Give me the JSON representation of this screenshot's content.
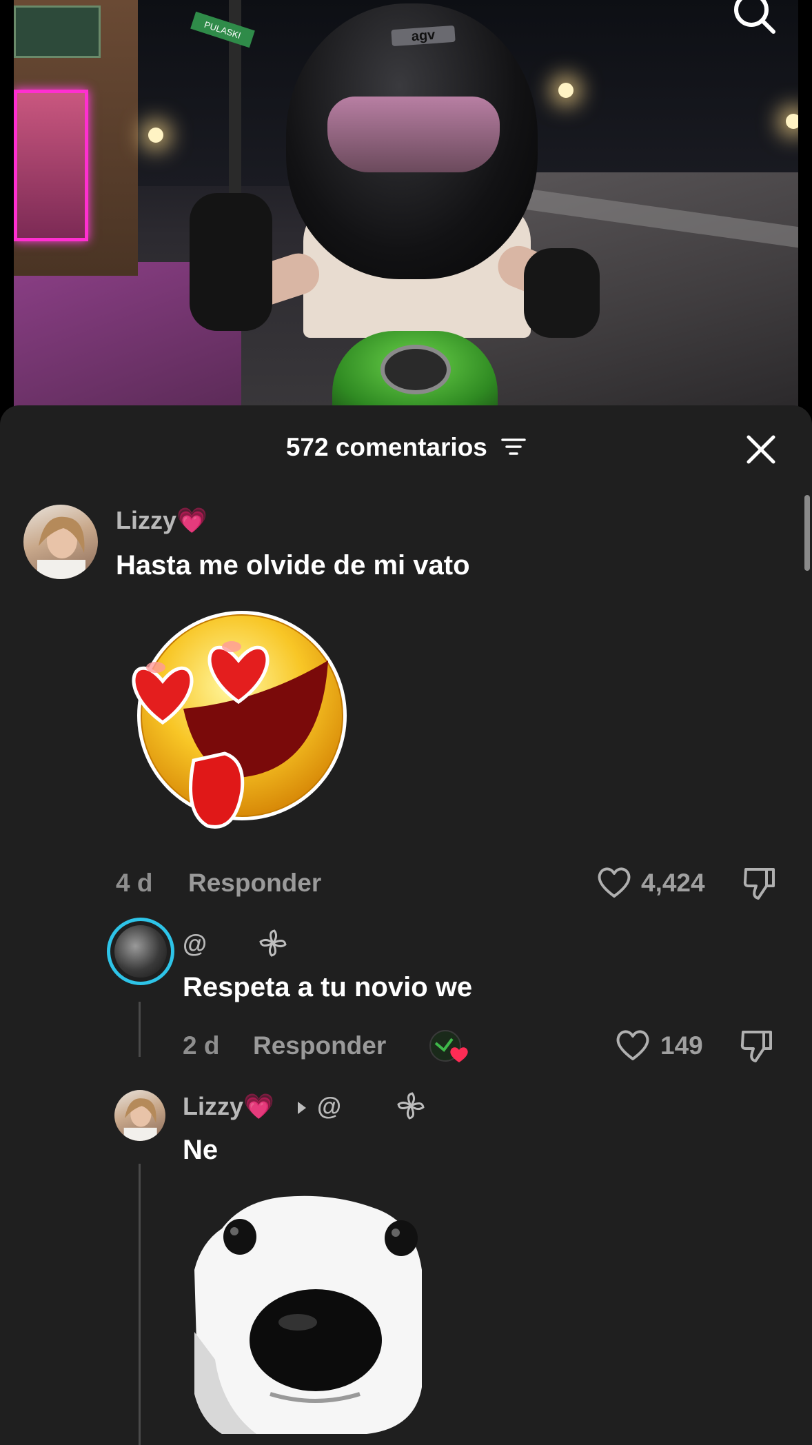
{
  "video": {
    "street_sign": "PULASKI",
    "helmet_brand": "agv"
  },
  "comments_sheet": {
    "title": "572 comentarios",
    "comments": [
      {
        "author": "Lizzy💗",
        "text": "Hasta me olvide de mi vato",
        "sticker": "heart-eyes-tongue-emoji",
        "age": "4 d",
        "reply_label": "Responder",
        "likes": "4,424"
      },
      {
        "author": "@",
        "text": "Respeta a tu novio we",
        "age": "2 d",
        "reply_label": "Responder",
        "likes": "149"
      },
      {
        "author": "Lizzy💗",
        "reply_to": "@",
        "text": "Ne",
        "sticker": "dog-face-sticker"
      }
    ]
  },
  "colors": {
    "sheet_bg": "#1f1f1f",
    "text_primary": "#ffffff",
    "text_secondary": "#8e8e8e",
    "story_ring": "#2ec4e8"
  }
}
